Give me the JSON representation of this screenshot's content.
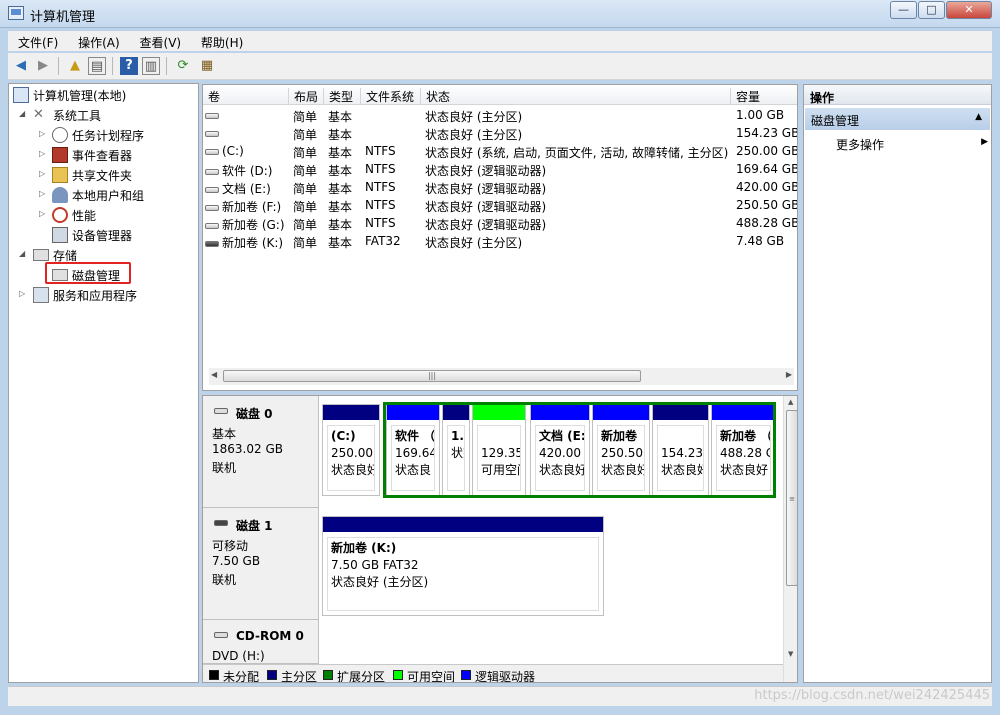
{
  "window": {
    "title": "计算机管理",
    "controls": [
      "minimize-icon",
      "maximize-icon",
      "close-icon"
    ]
  },
  "menu": [
    "文件(F)",
    "操作(A)",
    "查看(V)",
    "帮助(H)"
  ],
  "tree": {
    "root": "计算机管理(本地)",
    "system_tools": "系统工具",
    "tools": [
      "任务计划程序",
      "事件查看器",
      "共享文件夹",
      "本地用户和组",
      "性能",
      "设备管理器"
    ],
    "storage": "存储",
    "disk_management": "磁盘管理",
    "services": "服务和应用程序"
  },
  "volume_list": {
    "headers": [
      "卷",
      "布局",
      "类型",
      "文件系统",
      "状态",
      "容量"
    ],
    "rows": [
      {
        "volume": "",
        "layout": "简单",
        "type": "基本",
        "fs": "",
        "status": "状态良好 (主分区)",
        "capacity": "1.00 GB",
        "dark": false
      },
      {
        "volume": "",
        "layout": "简单",
        "type": "基本",
        "fs": "",
        "status": "状态良好 (主分区)",
        "capacity": "154.23 GB",
        "dark": false
      },
      {
        "volume": "(C:)",
        "layout": "简单",
        "type": "基本",
        "fs": "NTFS",
        "status": "状态良好 (系统, 启动, 页面文件, 活动, 故障转储, 主分区)",
        "capacity": "250.00 GB",
        "dark": false
      },
      {
        "volume": "软件 (D:)",
        "layout": "简单",
        "type": "基本",
        "fs": "NTFS",
        "status": "状态良好 (逻辑驱动器)",
        "capacity": "169.64 GB",
        "dark": false
      },
      {
        "volume": "文档 (E:)",
        "layout": "简单",
        "type": "基本",
        "fs": "NTFS",
        "status": "状态良好 (逻辑驱动器)",
        "capacity": "420.00 GB",
        "dark": false
      },
      {
        "volume": "新加卷 (F:)",
        "layout": "简单",
        "type": "基本",
        "fs": "NTFS",
        "status": "状态良好 (逻辑驱动器)",
        "capacity": "250.50 GB",
        "dark": false
      },
      {
        "volume": "新加卷 (G:)",
        "layout": "简单",
        "type": "基本",
        "fs": "NTFS",
        "status": "状态良好 (逻辑驱动器)",
        "capacity": "488.28 GB",
        "dark": false
      },
      {
        "volume": "新加卷 (K:)",
        "layout": "简单",
        "type": "基本",
        "fs": "FAT32",
        "status": "状态良好 (主分区)",
        "capacity": "7.48 GB",
        "dark": true
      }
    ]
  },
  "disks": [
    {
      "name": "磁盘 0",
      "kind": "基本",
      "size": "1863.02 GB",
      "state": "联机",
      "partitions": [
        {
          "lines": [
            "(C:)",
            "250.00 (",
            "状态良好"
          ],
          "color": "#000080"
        },
        {
          "lines": [
            "软件 （",
            "169.64",
            "状态良"
          ],
          "color": "#0000ff"
        },
        {
          "lines": [
            "1.0",
            "状态"
          ],
          "color": "#000080"
        },
        {
          "lines": [
            "",
            "129.35",
            "可用空间"
          ],
          "color": "#00ff00"
        },
        {
          "lines": [
            "文档 (E:",
            "420.00 (",
            "状态良好"
          ],
          "color": "#0000ff"
        },
        {
          "lines": [
            "新加卷",
            "250.50 (",
            "状态良好"
          ],
          "color": "#0000ff"
        },
        {
          "lines": [
            "",
            "154.23",
            "状态良好"
          ],
          "color": "#000080"
        },
        {
          "lines": [
            "新加卷 （",
            "488.28 G",
            "状态良好"
          ],
          "color": "#0000ff"
        }
      ]
    },
    {
      "name": "磁盘 1",
      "kind": "可移动",
      "size": "7.50 GB",
      "state": "联机",
      "partitions": [
        {
          "lines": [
            "新加卷 (K:)",
            "7.50 GB FAT32",
            "状态良好 (主分区)"
          ],
          "color": "#000080"
        }
      ]
    },
    {
      "name": "CD-ROM 0",
      "kind": "DVD (H:)",
      "size": "",
      "state": "",
      "partitions": []
    }
  ],
  "legend": [
    {
      "label": "未分配",
      "color": "#000000"
    },
    {
      "label": "主分区",
      "color": "#000080"
    },
    {
      "label": "扩展分区",
      "color": "#008000"
    },
    {
      "label": "可用空间",
      "color": "#00ff00"
    },
    {
      "label": "逻辑驱动器",
      "color": "#0000ff"
    }
  ],
  "actions": {
    "header": "操作",
    "section": "磁盘管理",
    "more": "更多操作"
  },
  "watermark": "https://blog.csdn.net/wei242425445"
}
